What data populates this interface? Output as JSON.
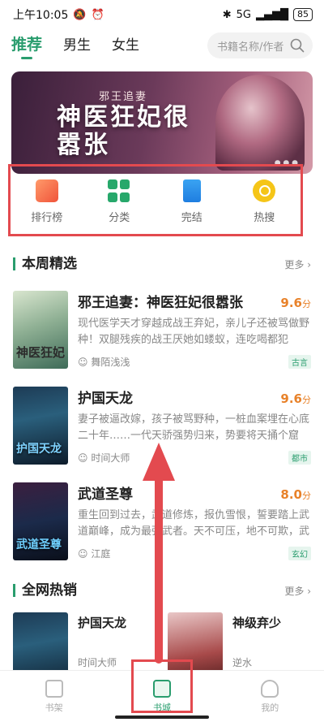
{
  "status": {
    "time": "上午10:05",
    "mute_icon": "bell-off-icon",
    "alarm_icon": "alarm-icon",
    "signal": "5G",
    "battery": "85"
  },
  "tabs": [
    {
      "label": "推荐"
    },
    {
      "label": "男生"
    },
    {
      "label": "女生"
    }
  ],
  "search": {
    "placeholder": "书籍名称/作者"
  },
  "banner": {
    "subtitle": "邪王追妻",
    "title": "神医狂妃很嚣张"
  },
  "quick_nav": [
    {
      "label": "排行榜",
      "icon": "rank-icon"
    },
    {
      "label": "分类",
      "icon": "category-icon"
    },
    {
      "label": "完结",
      "icon": "book-icon"
    },
    {
      "label": "热搜",
      "icon": "hot-search-icon"
    }
  ],
  "weekly": {
    "title": "本周精选",
    "more": "更多 ›",
    "books": [
      {
        "title": "邪王追妻：神医狂妃很嚣张",
        "score": "9.6",
        "unit": "分",
        "desc": "现代医学天才穿越成战王弃妃，亲儿子还被骂做野种！双腿残疾的战王厌她如蝼蚁，连吃喝都犯愁！...",
        "author": "舞陌浅浅",
        "tag": "古言",
        "cover_text": "神医狂妃"
      },
      {
        "title": "护国天龙",
        "score": "9.6",
        "unit": "分",
        "desc": "妻子被逼改嫁，孩子被骂野种，一桩血案埋在心底二十年……一代天骄强势归来，势要将天捅个窟窿！",
        "author": "时间大师",
        "tag": "都市",
        "cover_text": "护国天龙"
      },
      {
        "title": "武道圣尊",
        "score": "8.0",
        "unit": "分",
        "desc": "重生回到过去，武道修炼，报仇雪恨，誓要踏上武道巅峰，成为最强武者。天不可压，地不可欺，武道...",
        "author": "江庭",
        "tag": "玄幻",
        "cover_text": "武道圣尊"
      }
    ]
  },
  "hot": {
    "title": "全网热销",
    "more": "更多 ›",
    "books": [
      {
        "title": "护国天龙",
        "author": "时间大师"
      },
      {
        "title": "神级弃少",
        "author": "逆水"
      }
    ]
  },
  "bottom_nav": [
    {
      "label": "书架",
      "icon": "bookshelf-icon"
    },
    {
      "label": "书城",
      "icon": "home-icon"
    },
    {
      "label": "我的",
      "icon": "person-icon"
    }
  ],
  "colors": {
    "accent": "#2a9d6e",
    "score": "#e8822a",
    "highlight": "#e34a4f"
  }
}
